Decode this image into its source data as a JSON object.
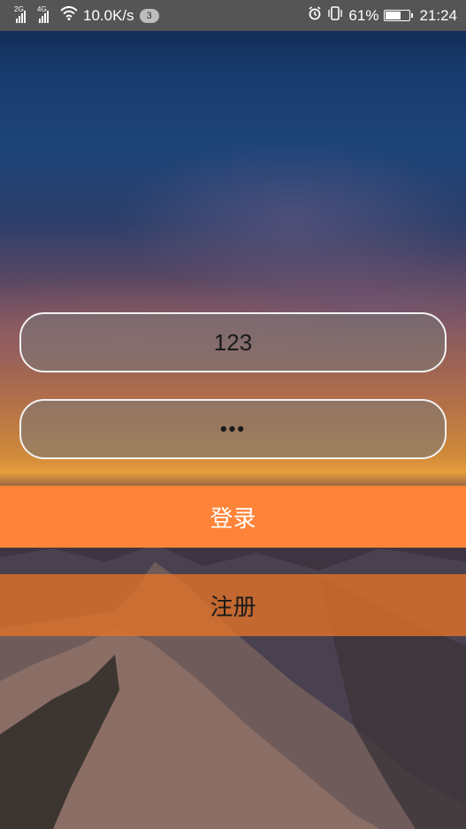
{
  "status_bar": {
    "signal1_tag": "2G",
    "signal2_tag": "4G",
    "speed": "10.0K/s",
    "notification_count": "3",
    "battery_percent": "61%",
    "time": "21:24"
  },
  "login_form": {
    "username_value": "123",
    "password_value": "•••",
    "login_label": "登录",
    "register_label": "注册"
  },
  "colors": {
    "accent": "#ff8439",
    "status_bar_bg": "#555555"
  }
}
